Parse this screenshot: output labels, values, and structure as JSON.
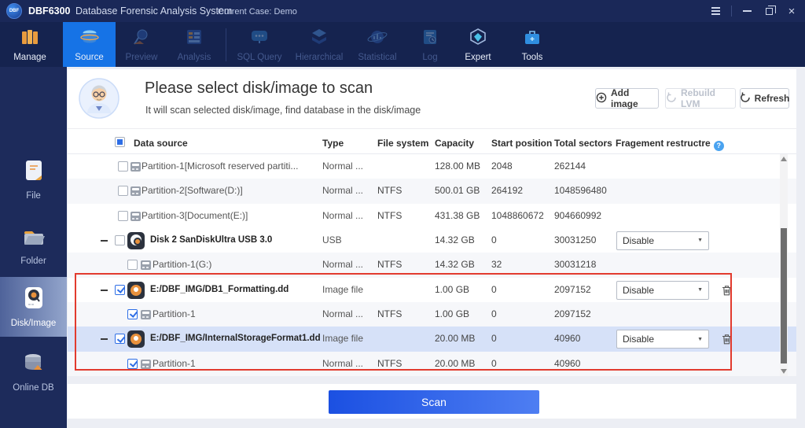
{
  "titlebar": {
    "logo_text": "DBF",
    "title_bold": "DBF6300",
    "title_rest": "Database Forensic Analysis System",
    "case_label": "Current Case: Demo"
  },
  "nav": {
    "items": [
      {
        "label": "Manage",
        "state": "normal",
        "icon": "manage-icon"
      },
      {
        "label": "Source",
        "state": "active",
        "icon": "source-icon"
      },
      {
        "label": "Preview",
        "state": "disabled",
        "icon": "preview-icon"
      },
      {
        "label": "Analysis",
        "state": "disabled",
        "icon": "analysis-icon"
      },
      {
        "label": "SQL Query",
        "state": "disabled",
        "icon": "sql-query-icon"
      },
      {
        "label": "Hierarchical",
        "state": "disabled",
        "icon": "hierarchical-icon"
      },
      {
        "label": "Statistical",
        "state": "disabled",
        "icon": "statistical-icon"
      },
      {
        "label": "Log",
        "state": "disabled",
        "icon": "log-icon"
      },
      {
        "label": "Expert",
        "state": "normal",
        "icon": "expert-icon"
      },
      {
        "label": "Tools",
        "state": "normal",
        "icon": "tools-icon"
      }
    ]
  },
  "sidebar": {
    "items": [
      {
        "label": "File",
        "state": "normal",
        "icon": "file-icon"
      },
      {
        "label": "Folder",
        "state": "normal",
        "icon": "folder-icon"
      },
      {
        "label": "Disk/Image",
        "state": "active",
        "icon": "disk-image-icon"
      },
      {
        "label": "Online DB",
        "state": "normal",
        "icon": "online-db-icon"
      }
    ]
  },
  "panel": {
    "title": "Please select disk/image to scan",
    "subtitle": "It will scan selected disk/image, find database in the disk/image",
    "buttons": [
      {
        "label": "Add image",
        "disabled": false,
        "icon": "add-circle-icon"
      },
      {
        "label": "Rebuild LVM",
        "disabled": true,
        "icon": "rebuild-icon"
      },
      {
        "label": "Refresh",
        "disabled": false,
        "icon": "refresh-icon"
      }
    ]
  },
  "table": {
    "select_all_state": "indeterminate",
    "headers": [
      "Data source",
      "Type",
      "File system",
      "Capacity",
      "Start position",
      "Total sectors",
      "Fragement restructre"
    ],
    "info_icon": "?",
    "rows": [
      {
        "indent": "top",
        "icon": "partition",
        "checked": false,
        "collapse": false,
        "name": "Partition-1[Microsoft reserved partiti...",
        "type": "Normal ...",
        "fs": "",
        "capacity": "128.00 MB",
        "start": "2048",
        "sectors": "262144",
        "dropdown": null,
        "trash": false,
        "shaded": false,
        "selected": false
      },
      {
        "indent": "top",
        "icon": "partition",
        "checked": false,
        "collapse": false,
        "name": "Partition-2[Software(D:)]",
        "type": "Normal ...",
        "fs": "NTFS",
        "capacity": "500.01 GB",
        "start": "264192",
        "sectors": "1048596480",
        "dropdown": null,
        "trash": false,
        "shaded": true,
        "selected": false
      },
      {
        "indent": "top",
        "icon": "partition",
        "checked": false,
        "collapse": false,
        "name": "Partition-3[Document(E:)]",
        "type": "Normal ...",
        "fs": "NTFS",
        "capacity": "431.38 GB",
        "start": "1048860672",
        "sectors": "904660992",
        "dropdown": null,
        "trash": false,
        "shaded": false,
        "selected": false
      },
      {
        "indent": "parent",
        "icon": "disk",
        "checked": false,
        "collapse": true,
        "name": "Disk 2 SanDiskUltra USB 3.0",
        "type": "USB",
        "fs": "",
        "capacity": "14.32 GB",
        "start": "0",
        "sectors": "30031250",
        "dropdown": "Disable",
        "trash": false,
        "shaded": false,
        "selected": false
      },
      {
        "indent": "child",
        "icon": "partition",
        "checked": false,
        "collapse": false,
        "name": "Partition-1(G:)",
        "type": "Normal ...",
        "fs": "NTFS",
        "capacity": "14.32 GB",
        "start": "32",
        "sectors": "30031218",
        "dropdown": null,
        "trash": false,
        "shaded": true,
        "selected": false
      },
      {
        "indent": "parent",
        "icon": "image",
        "checked": true,
        "collapse": true,
        "name": "E:/DBF_IMG/DB1_Formatting.dd",
        "type": "Image file",
        "fs": "",
        "capacity": "1.00 GB",
        "start": "0",
        "sectors": "2097152",
        "dropdown": "Disable",
        "trash": true,
        "shaded": false,
        "selected": false
      },
      {
        "indent": "child",
        "icon": "partition",
        "checked": true,
        "collapse": false,
        "name": "Partition-1",
        "type": "Normal ...",
        "fs": "NTFS",
        "capacity": "1.00 GB",
        "start": "0",
        "sectors": "2097152",
        "dropdown": null,
        "trash": false,
        "shaded": true,
        "selected": false
      },
      {
        "indent": "parent",
        "icon": "image",
        "checked": true,
        "collapse": true,
        "name": "E:/DBF_IMG/InternalStorageFormat1.dd",
        "type": "Image file",
        "fs": "",
        "capacity": "20.00 MB",
        "start": "0",
        "sectors": "40960",
        "dropdown": "Disable",
        "trash": true,
        "shaded": false,
        "selected": true
      },
      {
        "indent": "child",
        "icon": "partition",
        "checked": true,
        "collapse": false,
        "name": "Partition-1",
        "type": "Normal ...",
        "fs": "NTFS",
        "capacity": "20.00 MB",
        "start": "0",
        "sectors": "40960",
        "dropdown": null,
        "trash": false,
        "shaded": true,
        "selected": false
      }
    ]
  },
  "footer": {
    "scan_label": "Scan"
  },
  "colors": {
    "accent_blue": "#1673e6",
    "scan_gradient_start": "#1b50e2",
    "scan_gradient_end": "#4e7ef2",
    "annotation_red": "#e23b2e",
    "selected_row": "#d6e1f8",
    "titlebar_navy": "#1a2858",
    "sidebar_navy": "#1d2b5b"
  }
}
